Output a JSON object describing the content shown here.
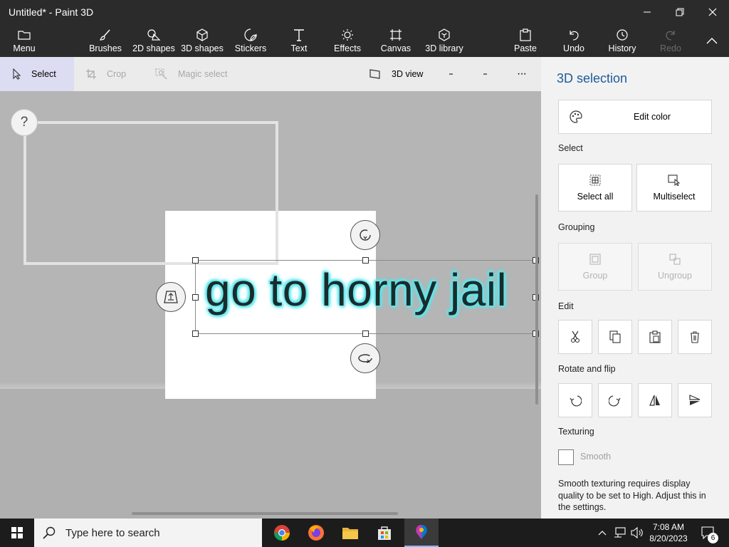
{
  "window": {
    "title": "Untitled* - Paint 3D",
    "minimize_icon": "minimize-icon",
    "maximize_icon": "restore-icon",
    "close_icon": "close-icon"
  },
  "toolbar": {
    "menu": "Menu",
    "brushes": "Brushes",
    "shapes2d": "2D shapes",
    "shapes3d": "3D shapes",
    "stickers": "Stickers",
    "text": "Text",
    "effects": "Effects",
    "canvas": "Canvas",
    "library": "3D library",
    "paste": "Paste",
    "undo": "Undo",
    "history": "History",
    "redo": "Redo"
  },
  "subbar": {
    "select": "Select",
    "crop": "Crop",
    "magic_select": "Magic select",
    "view3d": "3D view",
    "more": "···"
  },
  "canvas": {
    "help": "?",
    "selected_text": "go to horny jail",
    "glow_color": "#5ee8ee"
  },
  "panel": {
    "title": "3D selection",
    "edit_color": "Edit color",
    "select_label": "Select",
    "select_all": "Select all",
    "multiselect": "Multiselect",
    "grouping_label": "Grouping",
    "group": "Group",
    "ungroup": "Ungroup",
    "edit_label": "Edit",
    "rotate_label": "Rotate and flip",
    "texturing_label": "Texturing",
    "smooth": "Smooth",
    "smooth_note": "Smooth texturing requires display quality to be set to High. Adjust this in the settings.",
    "accent_color": "#1e5b9a"
  },
  "taskbar": {
    "search_placeholder": "Type here to search",
    "time": "7:08 AM",
    "date": "8/20/2023",
    "notification_count": "6"
  }
}
